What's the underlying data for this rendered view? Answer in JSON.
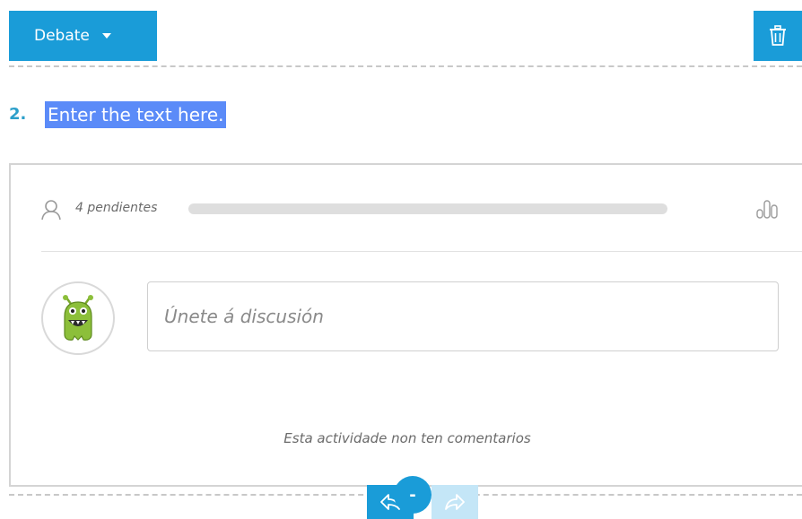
{
  "toolbar": {
    "type_label": "Debate",
    "dropdown_icon": "caret-down-icon",
    "delete_icon": "trash-icon"
  },
  "question": {
    "number": "2.",
    "text": "Enter the text here."
  },
  "activity": {
    "pending_label": "4 pendientes",
    "pending_icon": "user-icon",
    "stats_icon": "bar-chart-icon",
    "progress": 0,
    "input_placeholder": "Únete á discusión",
    "empty_message": "Esta actividade non ten comentarios",
    "avatar_icon": "green-monster-avatar"
  },
  "controls": {
    "undo_icon": "undo-icon",
    "minus_label": "-",
    "redo_icon": "redo-icon"
  },
  "colors": {
    "accent": "#1a9cd8",
    "accent_light": "#c4e6f7",
    "highlight": "#5b8bf8",
    "question_number": "#2c9fca"
  }
}
